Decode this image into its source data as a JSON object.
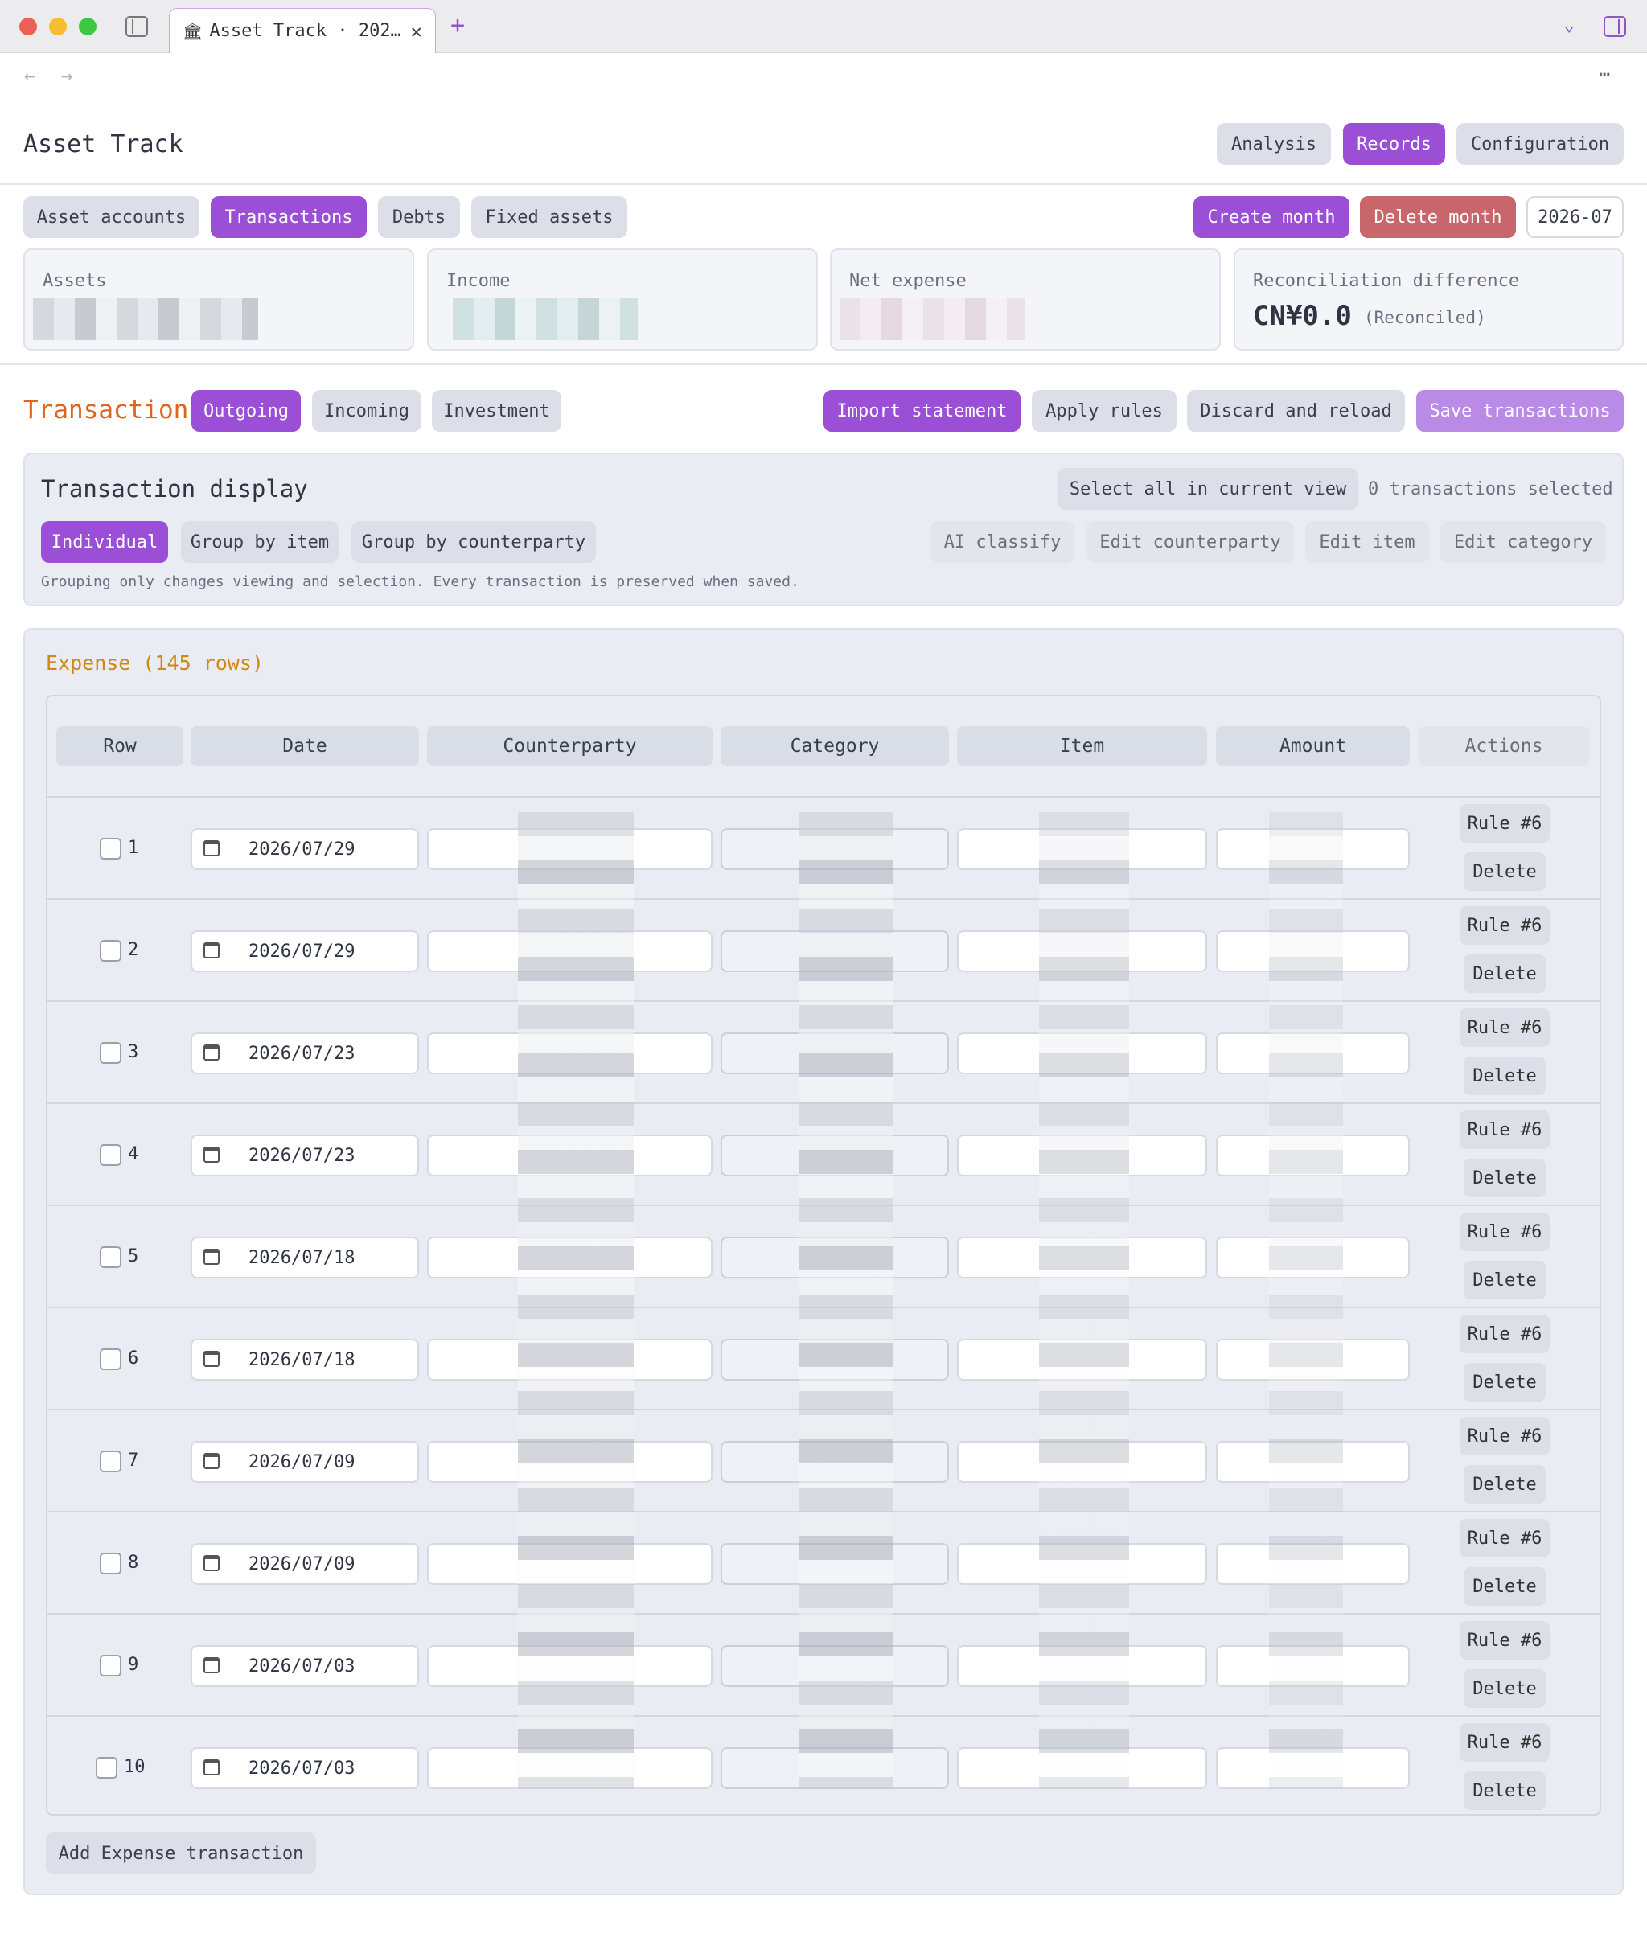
{
  "browser": {
    "tab_title": "Asset Track · 202…",
    "tab_icon": "🏛"
  },
  "app": {
    "title": "Asset Track",
    "top_nav": [
      "Analysis",
      "Records",
      "Configuration"
    ],
    "top_nav_active": "Records"
  },
  "subnav": {
    "items": [
      "Asset accounts",
      "Transactions",
      "Debts",
      "Fixed assets"
    ],
    "active": "Transactions",
    "create_month": "Create month",
    "delete_month": "Delete month",
    "month": "2026-07"
  },
  "summary": {
    "assets_label": "Assets",
    "income_label": "Income",
    "net_expense_label": "Net expense",
    "reconciliation_label": "Reconciliation difference",
    "reconciliation_value": "CN¥0.0",
    "reconciliation_status": "(Reconciled)"
  },
  "transactions": {
    "heading": "Transactions",
    "kinds": [
      "Outgoing",
      "Incoming",
      "Investment"
    ],
    "active_kind": "Outgoing",
    "import": "Import statement",
    "apply_rules": "Apply rules",
    "discard": "Discard and reload",
    "save": "Save transactions"
  },
  "display": {
    "heading": "Transaction display",
    "select_all": "Select all in current view",
    "selected_count": "0 transactions selected",
    "modes": [
      "Individual",
      "Group by item",
      "Group by counterparty"
    ],
    "active_mode": "Individual",
    "bulk_actions": [
      "AI classify",
      "Edit counterparty",
      "Edit item",
      "Edit category"
    ],
    "note": "Grouping only changes viewing and selection. Every transaction is preserved when saved."
  },
  "expense": {
    "heading": "Expense (145 rows)",
    "columns": [
      "Row",
      "Date",
      "Counterparty",
      "Category",
      "Item",
      "Amount",
      "Actions"
    ],
    "rows": [
      {
        "n": "1",
        "date": "2026/07/29",
        "rule": "Rule #6",
        "del": "Delete"
      },
      {
        "n": "2",
        "date": "2026/07/29",
        "rule": "Rule #6",
        "del": "Delete"
      },
      {
        "n": "3",
        "date": "2026/07/23",
        "rule": "Rule #6",
        "del": "Delete"
      },
      {
        "n": "4",
        "date": "2026/07/23",
        "rule": "Rule #6",
        "del": "Delete"
      },
      {
        "n": "5",
        "date": "2026/07/18",
        "rule": "Rule #6",
        "del": "Delete"
      },
      {
        "n": "6",
        "date": "2026/07/18",
        "rule": "Rule #6",
        "del": "Delete"
      },
      {
        "n": "7",
        "date": "2026/07/09",
        "rule": "Rule #6",
        "del": "Delete"
      },
      {
        "n": "8",
        "date": "2026/07/09",
        "rule": "Rule #6",
        "del": "Delete"
      },
      {
        "n": "9",
        "date": "2026/07/03",
        "rule": "Rule #6",
        "del": "Delete"
      },
      {
        "n": "10",
        "date": "2026/07/03",
        "rule": "Rule #6",
        "del": "Delete"
      }
    ],
    "add": "Add Expense transaction"
  },
  "colors": {
    "accent": "#9a4fd6",
    "danger": "#c8666c",
    "heading_orange": "#e0641e",
    "expense_orange": "#d08a12"
  }
}
